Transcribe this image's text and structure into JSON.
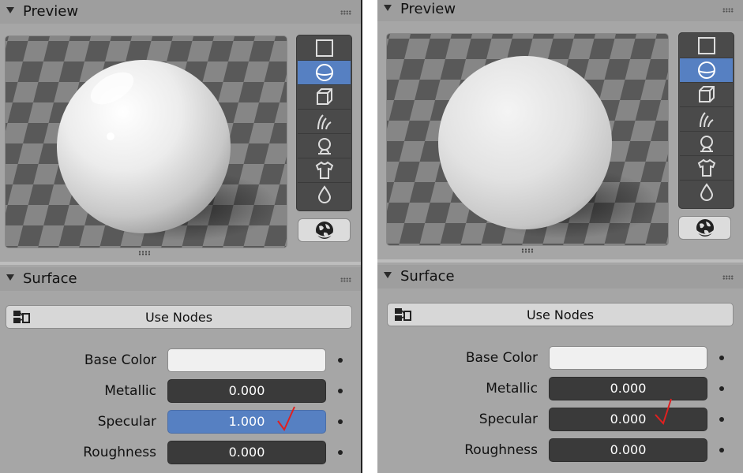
{
  "left": {
    "preview": {
      "title": "Preview"
    },
    "surface": {
      "title": "Surface",
      "use_nodes_label": "Use Nodes",
      "properties": [
        {
          "label": "Base Color",
          "kind": "color",
          "value": "#f0f0f0"
        },
        {
          "label": "Metallic",
          "kind": "number",
          "value": "0.000"
        },
        {
          "label": "Specular",
          "kind": "number",
          "value": "1.000",
          "selected": true,
          "annotation": "red-checkmark"
        },
        {
          "label": "Roughness",
          "kind": "number",
          "value": "0.000"
        }
      ]
    }
  },
  "right": {
    "preview": {
      "title": "Preview"
    },
    "surface": {
      "title": "Surface",
      "use_nodes_label": "Use Nodes",
      "properties": [
        {
          "label": "Base Color",
          "kind": "color",
          "value": "#f0f0f0"
        },
        {
          "label": "Metallic",
          "kind": "number",
          "value": "0.000"
        },
        {
          "label": "Specular",
          "kind": "number",
          "value": "0.000",
          "annotation": "red-checkmark"
        },
        {
          "label": "Roughness",
          "kind": "number",
          "value": "0.000"
        }
      ]
    }
  },
  "preview_types": [
    {
      "name": "flat-plane-icon"
    },
    {
      "name": "sphere-icon",
      "active": true
    },
    {
      "name": "cube-icon"
    },
    {
      "name": "hair-icon"
    },
    {
      "name": "monkey-icon"
    },
    {
      "name": "cloth-icon"
    },
    {
      "name": "fluid-drop-icon"
    }
  ],
  "world_button": {
    "name": "world-globe-icon"
  },
  "colors": {
    "panel": "#a6a6a6",
    "selected_field": "#5680c2",
    "dark_field": "#3a3a3a",
    "annotation": "#e02020"
  }
}
